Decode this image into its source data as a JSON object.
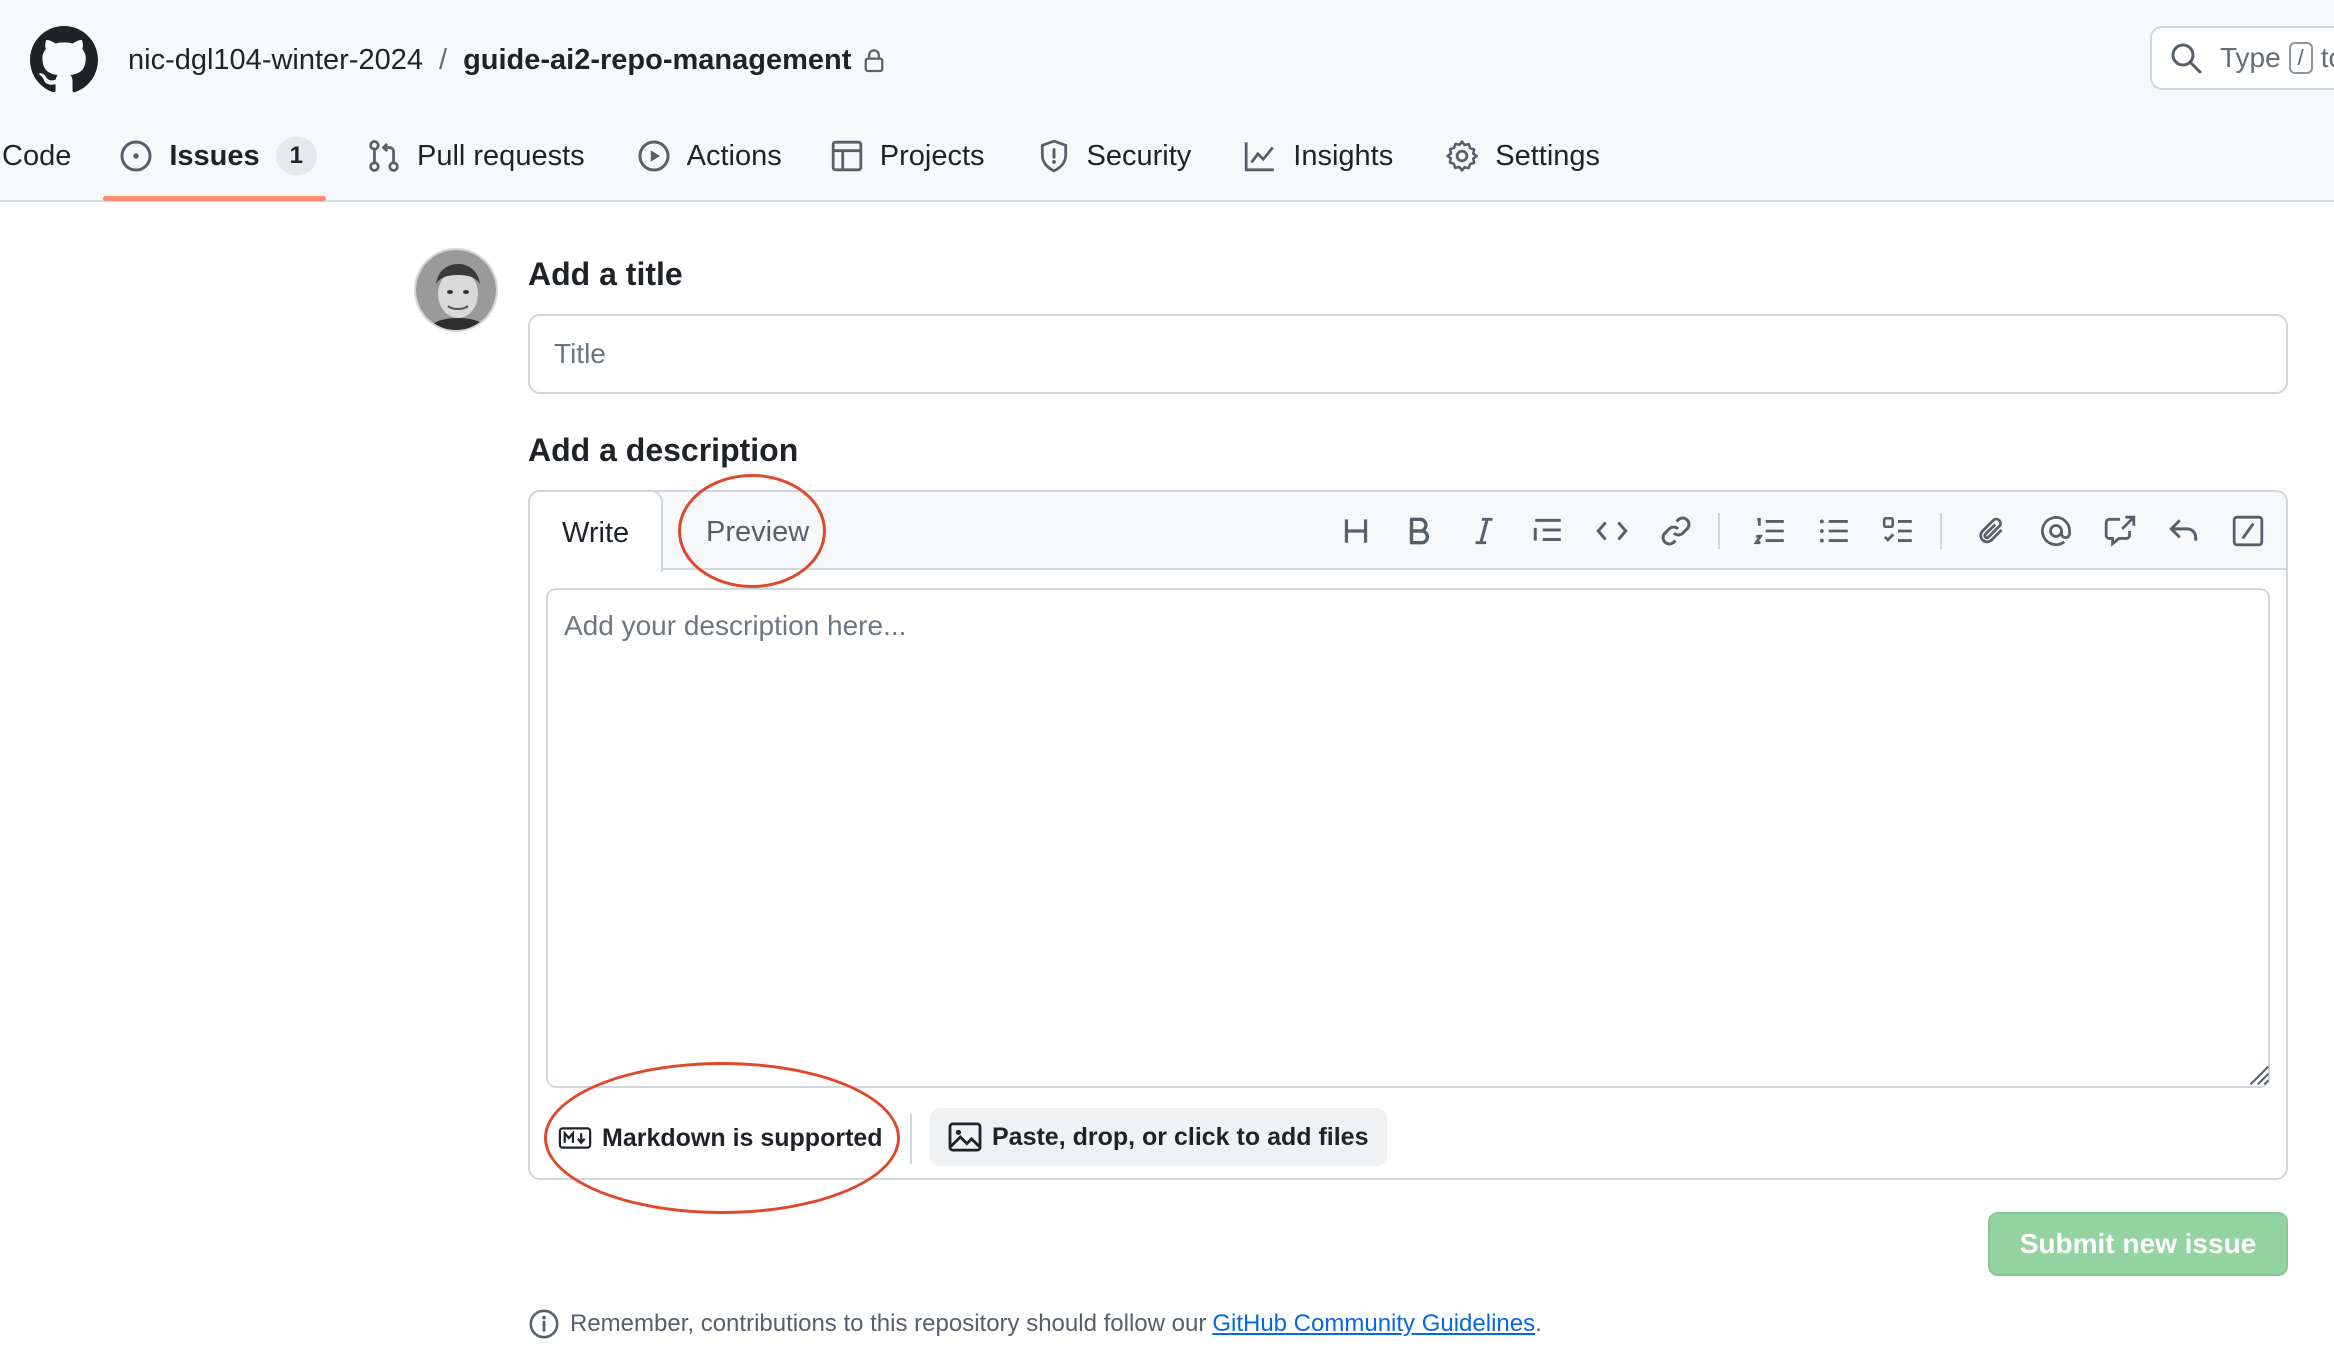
{
  "header": {
    "owner": "nic-dgl104-winter-2024",
    "separator": "/",
    "repo": "guide-ai2-repo-management",
    "search": {
      "prefix": "Type",
      "key": "/",
      "suffix": "to"
    }
  },
  "tabs": [
    {
      "label": "Code",
      "icon": "code-icon"
    },
    {
      "label": "Issues",
      "icon": "issue-opened-icon",
      "count": "1",
      "active": true
    },
    {
      "label": "Pull requests",
      "icon": "git-pull-request-icon"
    },
    {
      "label": "Actions",
      "icon": "play-icon"
    },
    {
      "label": "Projects",
      "icon": "table-icon"
    },
    {
      "label": "Security",
      "icon": "shield-icon"
    },
    {
      "label": "Insights",
      "icon": "graph-icon"
    },
    {
      "label": "Settings",
      "icon": "gear-icon"
    }
  ],
  "form": {
    "title_label": "Add a title",
    "title_placeholder": "Title",
    "description_label": "Add a description",
    "write_tab": "Write",
    "preview_tab": "Preview",
    "description_placeholder": "Add your description here...",
    "toolbar": [
      "heading-icon",
      "bold-icon",
      "italic-icon",
      "quote-icon",
      "code-icon",
      "link-icon",
      "ordered-list-icon",
      "unordered-list-icon",
      "task-list-icon",
      "attach-icon",
      "mention-icon",
      "cross-reference-icon",
      "reply-icon",
      "slash-command-icon"
    ],
    "markdown_note": "Markdown is supported",
    "attach_label": "Paste, drop, or click to add files",
    "submit_label": "Submit new issue"
  },
  "footer_note": {
    "text": "Remember, contributions to this repository should follow our",
    "link": "GitHub Community Guidelines",
    "end": "."
  },
  "colors": {
    "accent_underline": "#fd8c73",
    "submit_disabled": "#94d3a2",
    "annotation": "#e0482c",
    "link": "#0969da"
  }
}
